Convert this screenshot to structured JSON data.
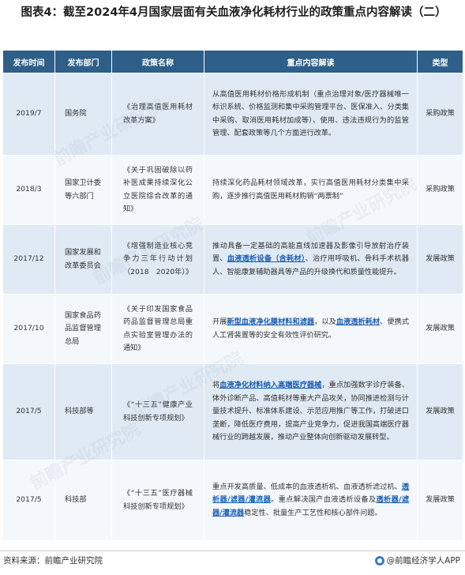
{
  "title": "图表4：截至2024年4月国家层面有关血液净化耗材行业的政策重点内容解读（二）",
  "headers": [
    "发布时间",
    "发布部门",
    "政策名称",
    "重点内容解读",
    "类型"
  ],
  "rows": [
    {
      "date": "2019/7",
      "dept": "国务院",
      "policy": "《治理高值医用耗材改革方案》",
      "content": [
        {
          "t": "从高值医用耗材价格形成机制（重点治理对象/医疗器械唯一标识系统、价格监测和集中采购管理平台、医保准入、分类集中采购、取消医用耗材加成等）、使用、违法违规行为的监管管理、配套政策等几个方面进行改革。"
        }
      ],
      "type": "采购政策"
    },
    {
      "date": "2018/3",
      "dept": "国家卫计委等六部门",
      "policy": "《关于巩固破除以药补医成果持续深化公立医院综合改革的通知》",
      "content": [
        {
          "t": "持续深化药品耗材领域改革，实行高值医用耗材分类集中采购，逐步推行高值医用耗材购销“两票制”"
        }
      ],
      "type": "采购政策"
    },
    {
      "date": "2017/12",
      "dept": "国家发展和改革委员会",
      "policy": "《增强制造业核心竞争力三年行动计划（2018　2020年）》",
      "content": [
        {
          "t": "推动具备一定基础的高能直线加速器及影像引导放射治疗装置、"
        },
        {
          "t": "血液透析设备（含耗材）",
          "hl": true
        },
        {
          "t": "、治疗用呼吸机、骨科手术机器人、智能康复辅助器具等产品的升级换代和质量性能提升。"
        }
      ],
      "type": "发展政策"
    },
    {
      "date": "2017/10",
      "dept": "国家食品药品监督管理总局",
      "policy": "《关于印发国家食品药品监督管理总局重点实验室管理办法的通知》",
      "content": [
        {
          "t": "开展"
        },
        {
          "t": "新型血液净化膜材料和滤器",
          "hl": true
        },
        {
          "t": "，以及"
        },
        {
          "t": "血液透析耗材",
          "hl": true
        },
        {
          "t": "、便携式人工肾装置等的安全有效性评价研究。"
        }
      ],
      "type": "发展政策"
    },
    {
      "date": "2017/5",
      "dept": "科技部等",
      "policy": "《“十三五”健康产业科技创新专项规划》",
      "content": [
        {
          "t": "将"
        },
        {
          "t": "血液净化材料纳入高端医疗器械",
          "hl": true
        },
        {
          "t": "，重点加强数字诊疗装备、体外诊断产品、高值耗材等重大产品攻关，协同推进检测与计量技术提升、标准体系建设、示范应用推广等工作，打破进口垄断，降低医疗费用，提高产业竞争力，促进我国高端医疗器械行业的跨越发展，推动产业整体向创新驱动发展转型。"
        }
      ],
      "type": "发展政策"
    },
    {
      "date": "2017/5",
      "dept": "科技部",
      "policy": "《“十三五”医疗器械科技创新专项规划》",
      "content": [
        {
          "t": "重点开发高质量、低成本的血液透析机、血液透析滤过机、"
        },
        {
          "t": "透析器/滤器/灌流器",
          "hl": true
        },
        {
          "t": "。重点解决国产血液透析设备及"
        },
        {
          "t": "透析器/滤器/灌流器",
          "hl": true
        },
        {
          "t": "稳定性、批量生产工艺性和核心部件问题。"
        }
      ],
      "type": "发展政策"
    }
  ],
  "source": "资料来源：前瞻产业研究院",
  "brand": "@前瞻经济学人APP",
  "watermark": "前瞻产业研究院"
}
